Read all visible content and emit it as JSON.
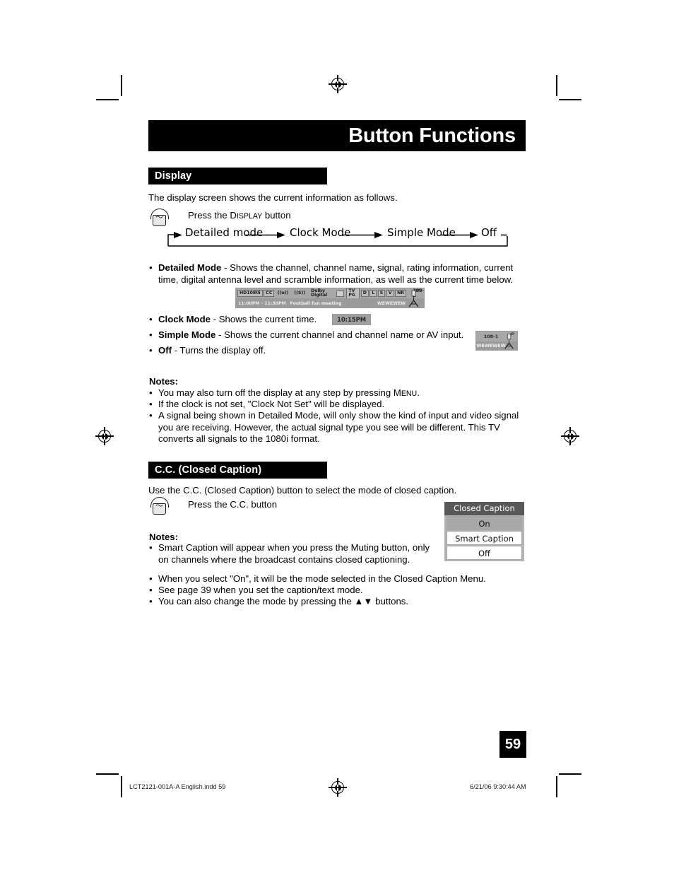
{
  "document": {
    "title": "Button Functions",
    "page_number": "59",
    "footer_left": "LCT2121-001A-A English.indd   59",
    "footer_right": "6/21/06   9:30:44 AM"
  },
  "display_section": {
    "heading": "Display",
    "intro": "The display screen shows the current information as follows.",
    "press_instruction_pre": "Press the D",
    "press_instruction_smallcaps": "ISPLAY",
    "press_instruction_post": " button",
    "flow": [
      "Detailed mode",
      "Clock Mode",
      "Simple Mode",
      "Off"
    ],
    "bullets": [
      {
        "term": "Detailed Mode",
        "text": " - Shows the channel, channel name, signal, rating information, current time, digital antenna level and scramble information, as well as the current time below."
      },
      {
        "term": "Clock Mode",
        "text": " - Shows the current time."
      },
      {
        "term": "Simple Mode",
        "text": " - Shows the current channel and channel name or AV input."
      },
      {
        "term": "Off",
        "text": " - Turns the display off."
      }
    ],
    "osd_detailed": {
      "format": "HD1080i",
      "cc": "CC",
      "audio_icon": "((o))",
      "signal_icon": "((S))",
      "audio_format": "Dolby Digital",
      "rating_tv": "TV PG",
      "rating_flags": [
        "D",
        "L",
        "S",
        "V"
      ],
      "rating_nr": "NR",
      "channel": "108-1",
      "time_range": "11:00PM - 11:30PM",
      "program": "Football fun meeting",
      "station": "WEWEWEW"
    },
    "osd_clock": "10:15PM",
    "osd_simple": {
      "channel": "108-1",
      "station": "WEWEWEW"
    },
    "notes_heading": "Notes:",
    "notes": [
      {
        "pre": "You may also turn off the display at any step by pressing M",
        "smallcaps": "ENU",
        "post": "."
      },
      {
        "pre": "If the clock is not set, \"Clock Not Set\" will be displayed.",
        "smallcaps": "",
        "post": ""
      },
      {
        "pre": "A signal being shown in Detailed Mode, will only show the kind of input and video signal you are receiving.  However, the actual signal type you see will be different.  This TV converts all signals to the 1080i format.",
        "smallcaps": "",
        "post": ""
      }
    ]
  },
  "cc_section": {
    "heading": "C.C. (Closed Caption)",
    "intro": "Use the C.C. (Closed Caption) button to select the mode of closed caption.",
    "press_instruction": "Press the C.C. button",
    "menu": {
      "title": "Closed Caption",
      "items": [
        {
          "label": "On",
          "selected": true
        },
        {
          "label": "Smart Caption",
          "selected": false
        },
        {
          "label": "Off",
          "selected": false
        }
      ]
    },
    "notes_heading": "Notes:",
    "notes": [
      "Smart Caption will appear when you press the Muting button, only on channels where the broadcast contains closed captioning.",
      "When you select \"On\", it will be the mode selected in the Closed Caption Menu.",
      "See page 39 when you set the caption/text mode.",
      "You can also change the mode by pressing the ▲▼ buttons."
    ]
  },
  "colors": {
    "ink": "#000000",
    "osd_gray": "#a8a8a8",
    "osd_header_gray": "#585858"
  }
}
